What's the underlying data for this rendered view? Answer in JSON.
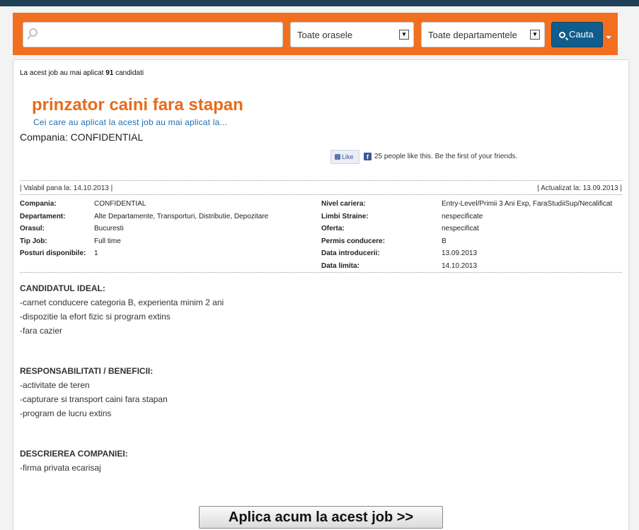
{
  "search": {
    "placeholder": "",
    "city_select": "Toate orasele",
    "dept_select": "Toate departamentele",
    "button_label": "Cauta"
  },
  "job": {
    "applicants_prefix": "La acest job au mai aplicat ",
    "applicants_count": "91",
    "applicants_suffix": " candidati",
    "title": "prinzator caini fara stapan",
    "others_link": "Cei care au aplicat la acest job au mai aplicat la...",
    "company_line": "Compania: CONFIDENTIAL",
    "like_label": "Like",
    "fb_text": "25 people like this. Be the first of your friends.",
    "valid_until": "| Valabil pana la: 14.10.2013 |",
    "updated": "| Actualizat la: 13.09.2013 |"
  },
  "details_left": [
    {
      "label": "Compania:",
      "value": "CONFIDENTIAL"
    },
    {
      "label": "Departament:",
      "value": "Alte Departamente, Transporturi, Distributie, Depozitare"
    },
    {
      "label": "Orasul:",
      "value": "Bucuresti"
    },
    {
      "label": "Tip Job:",
      "value": "Full time"
    },
    {
      "label": "Posturi disponibile:",
      "value": "1"
    }
  ],
  "details_right": [
    {
      "label": "Nivel cariera:",
      "value": "Entry-Level/Primii 3 Ani Exp, FaraStudiiSup/Necalificat"
    },
    {
      "label": "Limbi Straine:",
      "value": "nespecificate"
    },
    {
      "label": "Oferta:",
      "value": "nespecificat"
    },
    {
      "label": "Permis conducere:",
      "value": "B"
    },
    {
      "label": "Data introducerii:",
      "value": "13.09.2013"
    },
    {
      "label": "Data limita:",
      "value": "14.10.2013"
    }
  ],
  "sections": [
    {
      "heading": "CANDIDATUL IDEAL:",
      "lines": [
        "-carnet conducere categoria B, experienta minim 2 ani",
        "-dispozitie la efort fizic si program extins",
        "-fara cazier"
      ]
    },
    {
      "heading": "RESPONSABILITATI / BENEFICII:",
      "lines": [
        "-activitate de teren",
        "-capturare si transport caini fara stapan",
        "-program de lucru extins"
      ]
    },
    {
      "heading": "DESCRIEREA COMPANIEI:",
      "lines": [
        "-firma privata ecarisaj"
      ]
    }
  ],
  "apply_button": "Aplica acum la acest job >>",
  "icons": {
    "search_field": "search-icon",
    "search_button": "search-icon",
    "dropdown": "chevron-down-icon",
    "like": "thumbs-up-icon",
    "facebook": "facebook-icon"
  },
  "colors": {
    "accent_orange": "#f26f1f",
    "title_orange": "#e86b1a",
    "button_blue": "#0f5d8c",
    "link_blue": "#1f6fb3",
    "facebook_blue": "#3b5998"
  }
}
